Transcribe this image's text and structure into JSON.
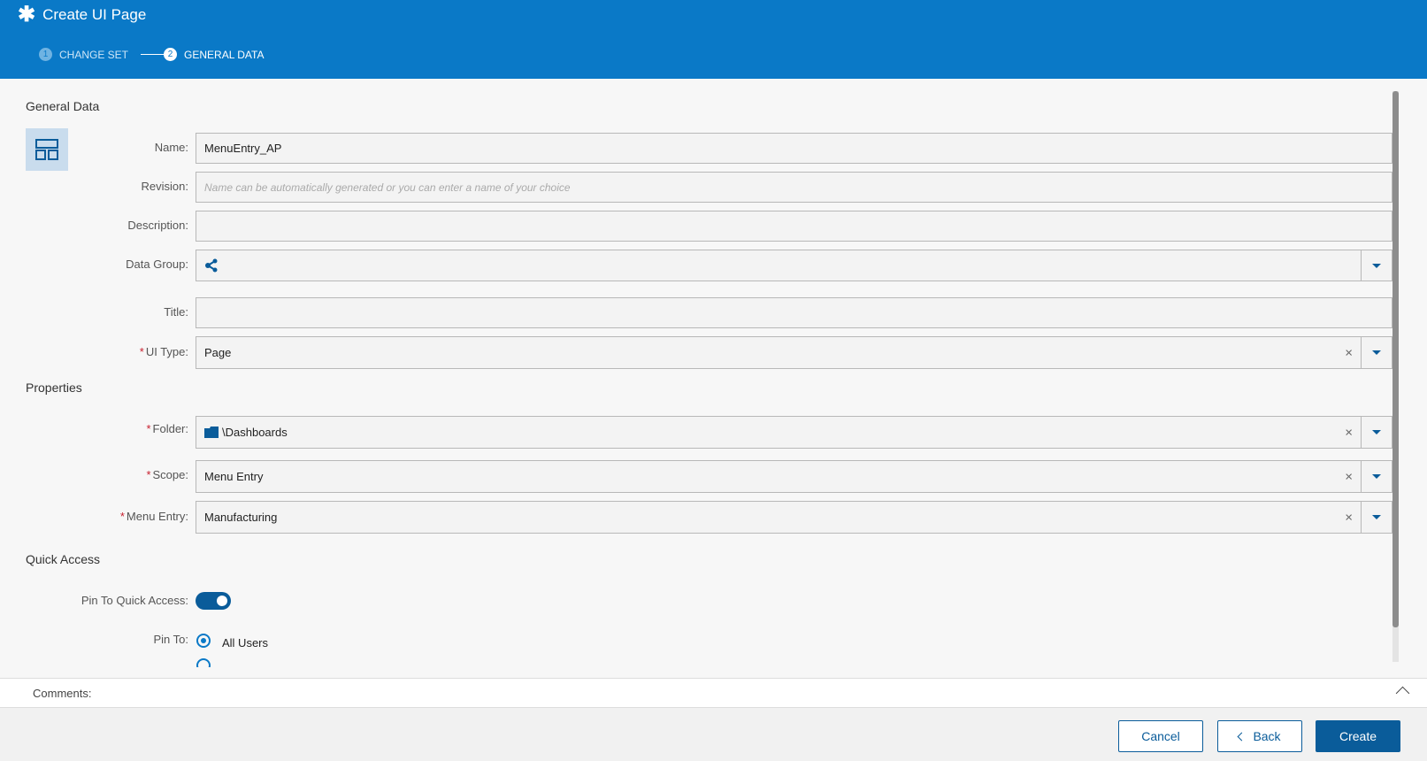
{
  "header": {
    "title": "Create UI Page",
    "steps": [
      {
        "num": "1",
        "label": "CHANGE SET"
      },
      {
        "num": "2",
        "label": "GENERAL DATA"
      }
    ]
  },
  "sections": {
    "general": "General Data",
    "properties": "Properties",
    "quick_access": "Quick Access"
  },
  "fields": {
    "name": {
      "label": "Name:",
      "value": "MenuEntry_AP"
    },
    "revision": {
      "label": "Revision:",
      "placeholder": "Name can be automatically generated or you can enter a name of your choice"
    },
    "description": {
      "label": "Description:",
      "value": ""
    },
    "data_group": {
      "label": "Data Group:",
      "value": ""
    },
    "title": {
      "label": "Title:",
      "value": ""
    },
    "ui_type": {
      "label": "UI Type:",
      "value": "Page"
    },
    "folder": {
      "label": "Folder:",
      "value": "\\Dashboards"
    },
    "scope": {
      "label": "Scope:",
      "value": "Menu Entry"
    },
    "menu_entry": {
      "label": "Menu Entry:",
      "value": "Manufacturing"
    },
    "pin_quick_access": {
      "label": "Pin To Quick Access:",
      "value": true
    },
    "pin_to": {
      "label": "Pin To:",
      "options": [
        "All Users"
      ],
      "selected": "All Users"
    }
  },
  "required_mark": "*",
  "clear_glyph": "×",
  "comments": {
    "label": "Comments:"
  },
  "buttons": {
    "cancel": "Cancel",
    "back": "Back",
    "create": "Create"
  },
  "colors": {
    "header": "#0a79c7",
    "primary": "#0a5c9a"
  }
}
